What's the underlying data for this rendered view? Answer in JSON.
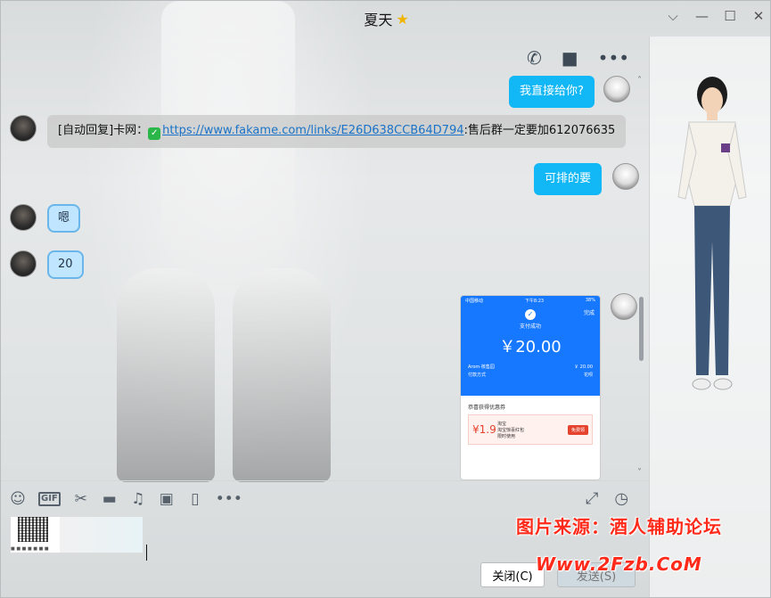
{
  "window": {
    "title": "夏天",
    "title_badge": "★",
    "controls": {
      "collapse": "⌵",
      "minimize": "—",
      "maximize": "☐",
      "close": "✕"
    }
  },
  "chat_toolbar": {
    "phone": "✆",
    "video": "■",
    "more": "•••"
  },
  "messages": [
    {
      "side": "out",
      "text": "我直接给你?"
    },
    {
      "side": "in",
      "prefix": "[自动回复]卡网：",
      "link": "https://www.fakame.com/links/E26D638CCB64D794",
      "suffix": ":售后群一定要加612076635"
    },
    {
      "side": "out",
      "text": "可排的要"
    },
    {
      "side": "in",
      "text": "嗯"
    },
    {
      "side": "in",
      "text": "20"
    }
  ],
  "payment_image": {
    "status_left": "中国移动",
    "status_center": "下午8:23",
    "status_right": "38%",
    "done": "完成",
    "title": "支付成功",
    "amount": "￥20.00",
    "payee_label": "Arom·核售园",
    "payee_amount": "￥ 20.00",
    "method_label": "付款方式",
    "method_value": "花呗",
    "coupon_title": "恭喜获得优惠券",
    "coupon_price": "¥1.9",
    "coupon_brand": "淘宝",
    "coupon_name": "淘宝惊喜红包",
    "coupon_note": "限时使用",
    "coupon_button": "免费领"
  },
  "input_toolbar": {
    "emoji": "☺",
    "gif": "GIF",
    "screenshot": "✂",
    "folder": "▬",
    "music": "♫",
    "image": "▣",
    "shake": "▯",
    "more": "•••",
    "expand": "⤢",
    "history": "◷"
  },
  "attachment_caption": "■ ■ ■ ■ ■ ■ ■",
  "buttons": {
    "close": "关闭(C)",
    "send": "发送(S)"
  },
  "watermark": {
    "line1": "图片来源：酒人辅助论坛",
    "line2": "Www.2Fzb.CoM"
  }
}
